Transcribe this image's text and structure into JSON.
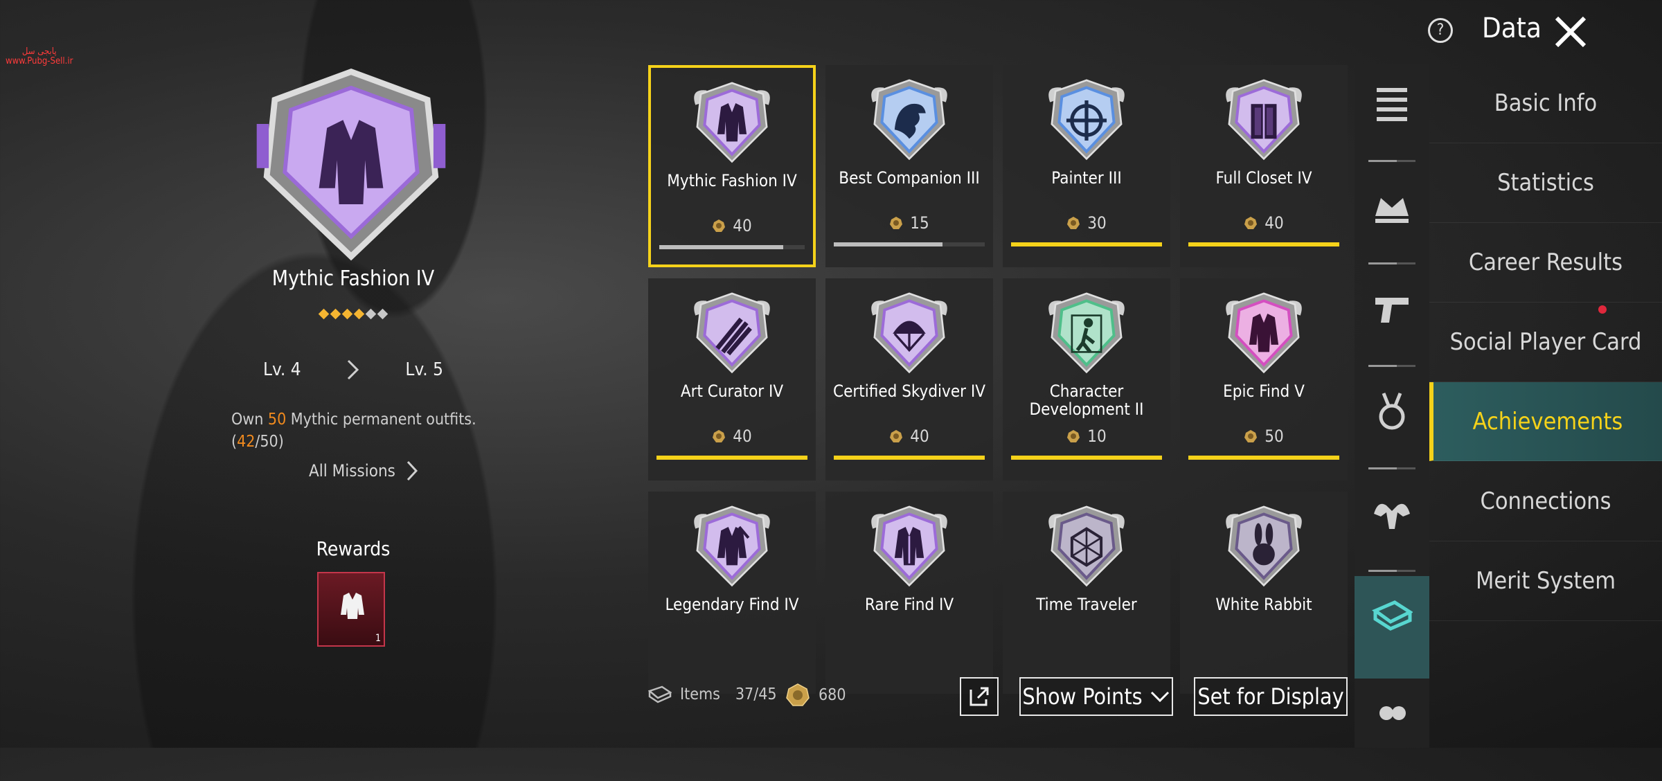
{
  "header": {
    "help_icon": "?",
    "title": "Data"
  },
  "watermark": {
    "line1": "پابجی سل",
    "line2": "www.Pubg-Sell.ir"
  },
  "detail": {
    "title": "Mythic Fashion IV",
    "stars_total": 6,
    "stars_filled": 4,
    "level_from": "Lv. 4",
    "level_to": "Lv. 5",
    "desc_pre": "Own ",
    "desc_num": "50",
    "desc_post": " Mythic permanent outfits.",
    "progress_open": "(",
    "progress_current": "42",
    "progress_rest": "/50)",
    "all_missions": "All Missions",
    "rewards_label": "Rewards",
    "reward_qty": "1"
  },
  "achievements": [
    {
      "name": "Mythic Fashion IV",
      "points": "40",
      "progress": 0.85,
      "color": "#9c6bd8",
      "icon": "jacket-icon",
      "selected": true
    },
    {
      "name": "Best Companion III",
      "points": "15",
      "progress": 0.72,
      "color": "#5a8fe0",
      "icon": "eagle-icon"
    },
    {
      "name": "Painter III",
      "points": "30",
      "progress": 1,
      "color": "#5a8fe0",
      "icon": "crosshair-icon"
    },
    {
      "name": "Full Closet IV",
      "points": "40",
      "progress": 1,
      "color": "#9c6bd8",
      "icon": "closet-icon"
    },
    {
      "name": "Art Curator IV",
      "points": "40",
      "progress": 1,
      "color": "#9c6bd8",
      "icon": "brush-icon"
    },
    {
      "name": "Certified Skydiver IV",
      "points": "40",
      "progress": 1,
      "color": "#9c6bd8",
      "icon": "parachute-icon"
    },
    {
      "name": "Character Development II",
      "points": "10",
      "progress": 1,
      "color": "#4fbf8a",
      "icon": "character-icon"
    },
    {
      "name": "Epic Find V",
      "points": "50",
      "progress": 1,
      "color": "#d44fc0",
      "icon": "outfit-icon"
    },
    {
      "name": "Legendary Find IV",
      "points": "",
      "progress": null,
      "color": "#9c6bd8",
      "icon": "legendary-outfit-icon"
    },
    {
      "name": "Rare Find IV",
      "points": "",
      "progress": null,
      "color": "#9c6bd8",
      "icon": "rare-outfit-icon"
    },
    {
      "name": "Time Traveler",
      "points": "",
      "progress": null,
      "color": "#6a5a8a",
      "icon": "hexagon-icon"
    },
    {
      "name": "White Rabbit",
      "points": "",
      "progress": null,
      "color": "#6a5a8a",
      "icon": "rabbit-icon"
    }
  ],
  "footer": {
    "items_label": "Items",
    "items_value": "37/45",
    "points_total": "680",
    "show_points": "Show Points",
    "set_display": "Set for Display"
  },
  "categories": [
    {
      "icon": "list-icon"
    },
    {
      "icon": "crown-icon"
    },
    {
      "icon": "pistol-icon"
    },
    {
      "icon": "medal-icon"
    },
    {
      "icon": "muscle-icon"
    },
    {
      "icon": "wardrobe-icon",
      "active": true
    },
    {
      "icon": "friends-icon"
    }
  ],
  "nav": [
    {
      "label": "Basic Info"
    },
    {
      "label": "Statistics"
    },
    {
      "label": "Career Results"
    },
    {
      "label": "Social Player Card",
      "notif": true
    },
    {
      "label": "Achievements",
      "active": true
    },
    {
      "label": "Connections"
    },
    {
      "label": "Merit System"
    }
  ],
  "colors": {
    "accent": "#f5d21a",
    "orange": "#f08a1e",
    "teal": "#2e5557",
    "red_dot": "#e0283c"
  }
}
